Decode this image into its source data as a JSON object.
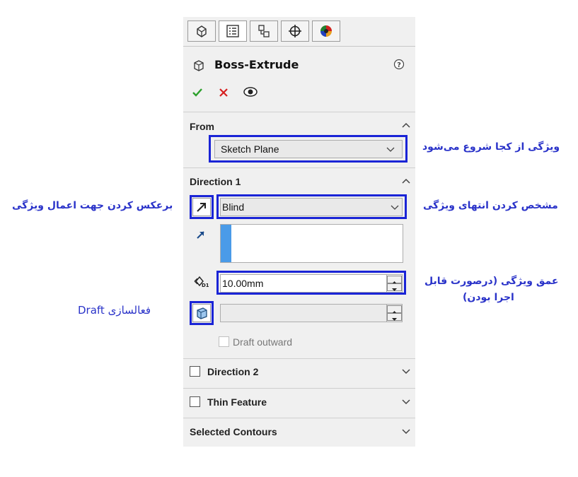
{
  "panel": {
    "tabs": [
      {
        "icon": "feature-manager-icon"
      },
      {
        "icon": "property-manager-icon",
        "active": true
      },
      {
        "icon": "configuration-manager-icon"
      },
      {
        "icon": "dimxpert-icon"
      },
      {
        "icon": "display-manager-icon"
      }
    ],
    "title": "Boss-Extrude",
    "help_icon": "help-icon",
    "actions": {
      "ok": "check-icon",
      "cancel": "x-icon",
      "preview": "eye-icon"
    },
    "from": {
      "label": "From",
      "value": "Sketch Plane"
    },
    "direction1": {
      "label": "Direction 1",
      "end_condition": "Blind",
      "depth": "10.00mm",
      "draft_angle": "",
      "draft_outward": "Draft outward"
    },
    "direction2": {
      "label": "Direction 2"
    },
    "thin_feature": {
      "label": "Thin Feature"
    },
    "selected_contours": {
      "label": "Selected Contours"
    }
  },
  "annotations": {
    "from": "ویژگی از کجا شروع می‌شود",
    "end_condition": "مشخص کردن انتهای ویژگی",
    "reverse": "برعکس کردن جهت اعمال ویژگی",
    "depth_line1": "عمق ویژگی (درصورت قابل",
    "depth_line2": "اجرا بودن)",
    "draft": "فعالسازی Draft"
  },
  "colors": {
    "highlight": "#1a24d6",
    "annotation": "#2a33c9",
    "ok": "#2ca02c",
    "cancel": "#d62020",
    "selection": "#4a9be8"
  }
}
